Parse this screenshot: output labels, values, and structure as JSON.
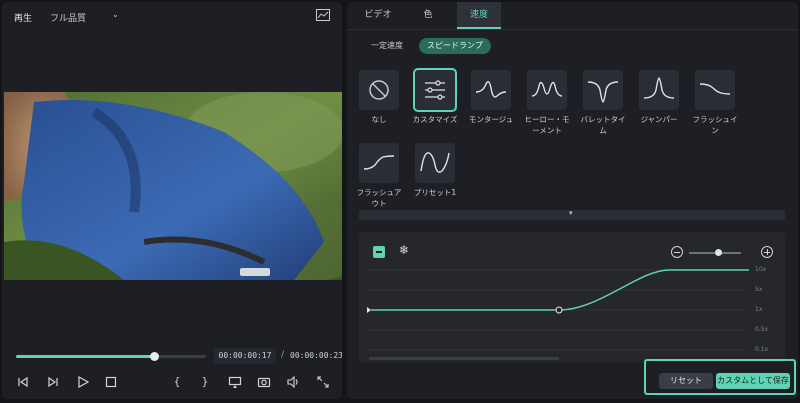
{
  "player": {
    "play_label": "再生",
    "quality": "フル品質",
    "progress": 0.725,
    "current_time": "00:00:00:17",
    "separator": "/",
    "total_time": "00:00:00:23",
    "control_icons": [
      "prev-frame-icon",
      "next-frame-icon",
      "play-icon",
      "stop-icon",
      "mark-in-icon",
      "mark-out-icon",
      "display-icon",
      "snapshot-icon",
      "volume-icon",
      "fullscreen-icon"
    ],
    "mark_in_glyph": "{",
    "mark_out_glyph": "}"
  },
  "tabs": [
    {
      "label": "ビデオ",
      "active": false
    },
    {
      "label": "色",
      "active": false
    },
    {
      "label": "速度",
      "active": true
    }
  ],
  "subtabs": [
    {
      "label": "一定速度",
      "active": false
    },
    {
      "label": "スピードランプ",
      "active": true
    }
  ],
  "presets": [
    {
      "label": "なし",
      "icon": "none-icon"
    },
    {
      "label": "カスタマイズ",
      "icon": "sliders-icon",
      "selected": true
    },
    {
      "label": "モンタージュ",
      "icon": "montage-curve-icon"
    },
    {
      "label": "ヒーロー・モーメント",
      "icon": "hero-moment-curve-icon"
    },
    {
      "label": "バレットタイム",
      "icon": "bullet-time-curve-icon"
    },
    {
      "label": "ジャンパー",
      "icon": "jumper-curve-icon"
    },
    {
      "label": "フラッシュイン",
      "icon": "flash-in-curve-icon"
    },
    {
      "label": "フラッシュアウト",
      "icon": "flash-out-curve-icon"
    },
    {
      "label": "プリセット1",
      "icon": "preset-curve-icon"
    }
  ],
  "graph": {
    "y_labels": [
      "10x",
      "5x",
      "1x",
      "0.5x",
      "0.1x"
    ]
  },
  "buttons": {
    "reset": "リセット",
    "save_custom": "カスタムとして保存"
  },
  "colors": {
    "accent": "#5fd3b3",
    "panel": "#1d1f24",
    "background": "#141518"
  }
}
